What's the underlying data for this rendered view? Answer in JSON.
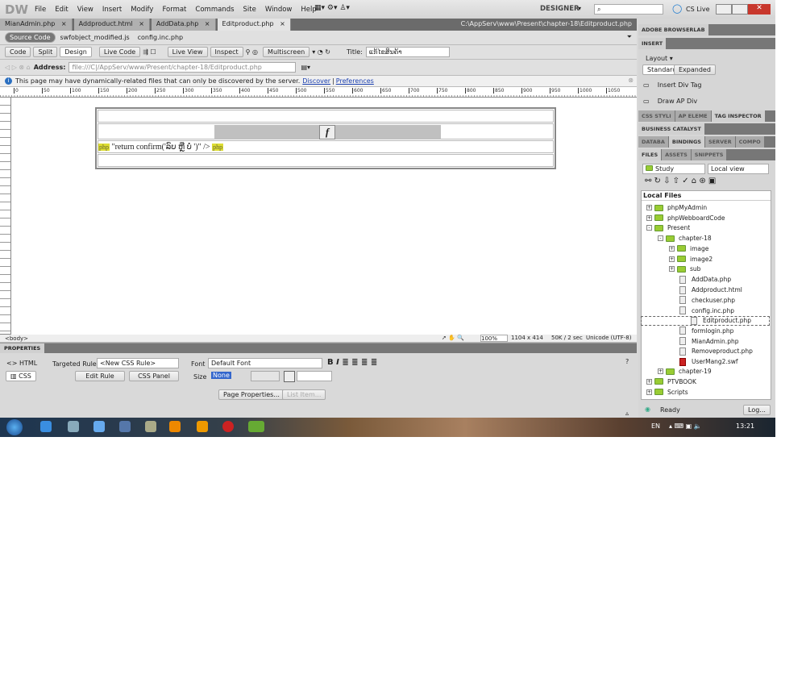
{
  "app": {
    "logo": "DW",
    "menus": [
      "File",
      "Edit",
      "View",
      "Insert",
      "Modify",
      "Format",
      "Commands",
      "Site",
      "Window",
      "Help"
    ],
    "workspace": "DESIGNER",
    "cs_live": "CS Live"
  },
  "doc_tabs": [
    "MianAdmin.php",
    "Addproduct.html",
    "AddData.php",
    "Editproduct.php"
  ],
  "doc_path": "C:\\AppServ\\www\\Present\\chapter-18\\Editproduct.php",
  "related_files": [
    "Source Code",
    "swfobject_modified.js",
    "config.inc.php"
  ],
  "toolbar": {
    "code": "Code",
    "split": "Split",
    "design": "Design",
    "live_code": "Live Code",
    "live_view": "Live View",
    "inspect": "Inspect",
    "multiscreen": "Multiscreen",
    "title_label": "Title:",
    "title_value": "ແກ້ໄຂສິນຄ້າ"
  },
  "address": {
    "label": "Address:",
    "value": "file:///C|/AppServ/www/Present/chapter-18/Editproduct.php"
  },
  "infobar": {
    "text": "This page may have dynamically-related files that can only be discovered by the server.",
    "discover": "Discover",
    "sep": "|",
    "preferences": "Preferences"
  },
  "ruler_ticks": [
    "0",
    "50",
    "100",
    "150",
    "200",
    "250",
    "300",
    "350",
    "400",
    "450",
    "500",
    "550",
    "600",
    "650",
    "700",
    "750",
    "800",
    "850",
    "900",
    "950",
    "1000",
    "1050"
  ],
  "design": {
    "row3_text": "\"return confirm('ລົບ ຫຼື ບໍ່ ')\" />"
  },
  "statusbar": {
    "tag": "<body>",
    "zoom": "100%",
    "size": "1104 x 414",
    "download": "50K / 2 sec",
    "encoding": "Unicode (UTF-8)"
  },
  "properties": {
    "title": "PROPERTIES",
    "html": "HTML",
    "css": "CSS",
    "targeted_rule_label": "Targeted Rule",
    "targeted_rule": "<New CSS Rule>",
    "edit_rule": "Edit Rule",
    "css_panel": "CSS Panel",
    "font_label": "Font",
    "font": "Default Font",
    "size_label": "Size",
    "size": "None",
    "page_properties": "Page Properties...",
    "list_item": "List Item..."
  },
  "panels": {
    "browserlab": "ADOBE BROWSERLAB",
    "insert": "INSERT",
    "layout": "Layout",
    "standard": "Standard",
    "expanded": "Expanded",
    "insert_items": [
      "Insert Div Tag",
      "Draw AP Div"
    ],
    "css_tabs": [
      "CSS STYLI",
      "AP ELEME",
      "TAG INSPECTOR"
    ],
    "business": "BUSINESS CATALYST",
    "data_tabs": [
      "DATABA",
      "BINDINGS",
      "SERVER",
      "COMPO"
    ],
    "files_tabs": [
      "FILES",
      "ASSETS",
      "SNIPPETS"
    ],
    "site": "Study",
    "view": "Local view",
    "local_files": "Local Files",
    "status": "Ready",
    "log": "Log..."
  },
  "tree": [
    {
      "name": "phpMyAdmin",
      "type": "folder",
      "level": 1,
      "pm": "+"
    },
    {
      "name": "phpWebboardCode",
      "type": "folder",
      "level": 1,
      "pm": "+"
    },
    {
      "name": "Present",
      "type": "folder",
      "level": 1,
      "pm": "-"
    },
    {
      "name": "chapter-18",
      "type": "folder",
      "level": 2,
      "pm": "-"
    },
    {
      "name": "image",
      "type": "folder",
      "level": 3,
      "pm": "+"
    },
    {
      "name": "image2",
      "type": "folder",
      "level": 3,
      "pm": "+"
    },
    {
      "name": "sub",
      "type": "folder",
      "level": 3,
      "pm": "+"
    },
    {
      "name": "AddData.php",
      "type": "file",
      "level": 3
    },
    {
      "name": "Addproduct.html",
      "type": "file",
      "level": 3
    },
    {
      "name": "checkuser.php",
      "type": "file",
      "level": 3
    },
    {
      "name": "config.inc.php",
      "type": "file",
      "level": 3
    },
    {
      "name": "Editproduct.php",
      "type": "file",
      "level": 3,
      "selected": true
    },
    {
      "name": "formlogin.php",
      "type": "file",
      "level": 3
    },
    {
      "name": "MianAdmin.php",
      "type": "file",
      "level": 3
    },
    {
      "name": "Removeproduct.php",
      "type": "file",
      "level": 3
    },
    {
      "name": "UserMang2.swf",
      "type": "swf",
      "level": 3
    },
    {
      "name": "chapter-19",
      "type": "folder",
      "level": 2,
      "pm": "+"
    },
    {
      "name": "PTVBOOK",
      "type": "folder",
      "level": 1,
      "pm": "+"
    },
    {
      "name": "Scripts",
      "type": "folder",
      "level": 1,
      "pm": "+"
    }
  ],
  "taskbar": {
    "lang": "EN",
    "time": "13:21"
  }
}
